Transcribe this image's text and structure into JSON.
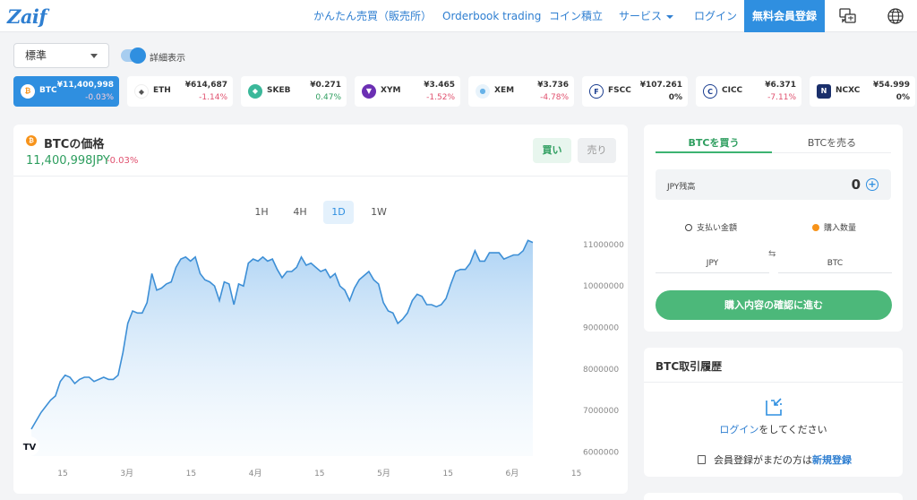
{
  "brand": {
    "logo_text": "Zaif"
  },
  "nav": {
    "items": [
      "かんたん売買（販売所）",
      "Orderbook trading",
      "コイン積立",
      "サービス",
      "ログイン"
    ],
    "signup": "無料会員登録"
  },
  "controls": {
    "view_select": "標準",
    "detail_toggle_label": "詳細表示",
    "detail_toggle_on": true
  },
  "tickers": [
    {
      "symbol": "BTC",
      "price": "¥11,400,998",
      "change": "-0.03%",
      "color": "#f7931a",
      "glyph": "₿"
    },
    {
      "symbol": "ETH",
      "price": "¥614,687",
      "change": "-1.14%",
      "color": "#ffffff",
      "glyph": "◆"
    },
    {
      "symbol": "SKEB",
      "price": "¥0.271",
      "change": "0.47%",
      "color": "#3bb89a",
      "glyph": "◆"
    },
    {
      "symbol": "XYM",
      "price": "¥3.465",
      "change": "-1.52%",
      "color": "#6b2fb3",
      "glyph": "▼"
    },
    {
      "symbol": "XEM",
      "price": "¥3.736",
      "change": "-4.78%",
      "color": "#67b2e8",
      "glyph": "●"
    },
    {
      "symbol": "FSCC",
      "price": "¥107.261",
      "change": "0%",
      "color": "#1a3d8f",
      "glyph": "F"
    },
    {
      "symbol": "CICC",
      "price": "¥6.371",
      "change": "-7.11%",
      "color": "#1a3d8f",
      "glyph": "C"
    },
    {
      "symbol": "NCXC",
      "price": "¥54.999",
      "change": "0%",
      "color": "#1a2f6b",
      "glyph": "N"
    }
  ],
  "chart_panel": {
    "title": "BTCの価格",
    "price": "11,400,998JPY",
    "change": "-0.03%",
    "buy_tab": "買い",
    "sell_tab": "売り",
    "timeframes": [
      "1H",
      "4H",
      "1D",
      "1W"
    ],
    "active_timeframe": "1D",
    "watermark": "TV"
  },
  "chart_data": {
    "type": "area",
    "title": "",
    "xlabel": "",
    "ylabel": "",
    "x_ticks": [
      "15",
      "3月",
      "15",
      "4月",
      "15",
      "5月",
      "15",
      "6月",
      "15"
    ],
    "y_ticks": [
      "6000000",
      "7000000",
      "8000000",
      "9000000",
      "10000000",
      "11000000"
    ],
    "ylim": [
      5900000,
      11300000
    ],
    "series": [
      {
        "values": [
          6550000,
          6750000,
          6950000,
          7100000,
          7250000,
          7350000,
          7700000,
          7850000,
          7800000,
          7650000,
          7750000,
          7800000,
          7800000,
          7700000,
          7750000,
          7800000,
          7750000,
          7750000,
          7850000,
          8400000,
          9100000,
          9400000,
          9350000,
          9350000,
          9600000,
          10300000,
          9900000,
          9950000,
          10050000,
          10100000,
          10450000,
          10650000,
          10700000,
          10600000,
          10700000,
          10300000,
          10150000,
          10100000,
          10000000,
          9650000,
          10100000,
          10050000,
          9550000,
          10050000,
          10000000,
          10550000,
          10650000,
          10600000,
          10700000,
          10600000,
          10650000,
          10400000,
          10200000,
          10350000,
          10350000,
          10450000,
          10700000,
          10500000,
          10550000,
          10450000,
          10350000,
          10400000,
          10200000,
          10300000,
          10000000,
          9900000,
          9650000,
          9950000,
          10150000,
          10250000,
          10350000,
          10150000,
          10050000,
          9600000,
          9400000,
          9350000,
          9100000,
          9200000,
          9350000,
          9650000,
          9800000,
          9750000,
          9550000,
          9550000,
          9500000,
          9550000,
          9700000,
          10050000,
          10350000,
          10400000,
          10400000,
          10550000,
          10850000,
          10600000,
          10600000,
          10800000,
          10800000,
          10800000,
          10650000,
          10700000,
          10750000,
          10750000,
          10850000,
          11100000,
          11050000
        ]
      }
    ]
  },
  "trade": {
    "tab_buy": "BTCを買う",
    "tab_sell": "BTCを売る",
    "balance_label": "JPY残高",
    "balance_value": "0",
    "mode_pay": "支払い金額",
    "mode_qty": "購入数量",
    "from_currency": "JPY",
    "to_currency": "BTC",
    "confirm": "購入内容の確認に進む"
  },
  "history": {
    "title": "BTC取引履歴",
    "login_link": "ログイン",
    "login_text": "をしてください",
    "register_text": "会員登録がまだの方は",
    "register_link": "新規登録"
  },
  "colors": {
    "accent": "#2f8fe0",
    "buy": "#4cb87a",
    "negative": "#e0506e",
    "positive": "#2e9e5f"
  }
}
